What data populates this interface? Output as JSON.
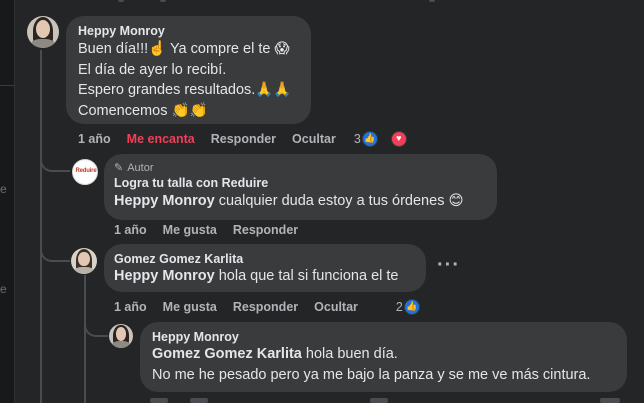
{
  "comments": [
    {
      "author": "Heppy Monroy",
      "lines": [
        "Buen día!!!☝️ Ya compre el te 😱",
        "El día de ayer lo recibí.",
        "Espero grandes resultados.🙏🙏",
        "Comencemos 👏👏"
      ],
      "actions": {
        "time": "1 año",
        "like": "Me encanta",
        "reply": "Responder",
        "hide": "Ocultar",
        "reaction_count": "3"
      }
    },
    {
      "badge": "Autor",
      "author": "Logra tu talla con Reduire",
      "avatar_text": "Reduire",
      "mention": "Heppy Monroy",
      "text": "cualquier duda estoy a tus órdenes 😊",
      "actions": {
        "time": "1 año",
        "like": "Me gusta",
        "reply": "Responder"
      }
    },
    {
      "author": "Gomez Gomez Karlita",
      "mention": "Heppy Monroy",
      "text": "hola que tal si funciona el te",
      "actions": {
        "time": "1 año",
        "like": "Me gusta",
        "reply": "Responder",
        "hide": "Ocultar",
        "reaction_count": "2"
      }
    },
    {
      "author": "Heppy Monroy",
      "mention": "Gomez Gomez Karlita",
      "text": "hola buen día.",
      "line2": "No me he pesado pero ya me bajo la panza y se me ve más cintura."
    }
  ],
  "left_gutter": {
    "chars": [
      "e",
      "e"
    ]
  },
  "icons": {
    "like": "like-reaction-icon",
    "love": "love-reaction-icon",
    "more": "more-options-icon",
    "pencil": "pencil-icon"
  },
  "colors": {
    "bg": "#242526",
    "bubble": "#3a3b3c",
    "love": "#f33e58",
    "like": "#1b74e4"
  }
}
